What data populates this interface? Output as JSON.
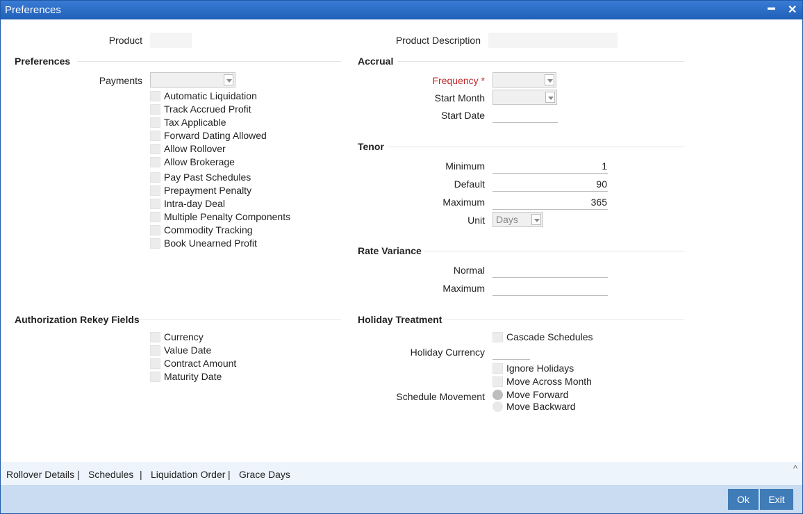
{
  "window": {
    "title": "Preferences",
    "minimize": "▬",
    "close": "✕"
  },
  "header": {
    "product_label": "Product",
    "product_value": "",
    "desc_label": "Product Description",
    "desc_value": ""
  },
  "preferences": {
    "title": "Preferences",
    "payments_label": "Payments",
    "payments_value": "",
    "checkboxes": [
      "Automatic Liquidation",
      "Track Accrued Profit",
      "Tax Applicable",
      "Forward Dating Allowed",
      "Allow Rollover",
      "Allow Brokerage",
      "Pay Past Schedules",
      "Prepayment Penalty",
      "Intra-day Deal",
      "Multiple Penalty Components",
      "Commodity Tracking",
      "Book Unearned Profit"
    ]
  },
  "accrual": {
    "title": "Accrual",
    "frequency_label": "Frequency",
    "required_mark": "*",
    "frequency_value": "",
    "start_month_label": "Start Month",
    "start_month_value": "",
    "start_date_label": "Start Date",
    "start_date_value": ""
  },
  "tenor": {
    "title": "Tenor",
    "minimum_label": "Minimum",
    "minimum_value": "1",
    "default_label": "Default",
    "default_value": "90",
    "maximum_label": "Maximum",
    "maximum_value": "365",
    "unit_label": "Unit",
    "unit_value": "Days"
  },
  "rate_variance": {
    "title": "Rate Variance",
    "normal_label": "Normal",
    "normal_value": "",
    "maximum_label": "Maximum",
    "maximum_value": ""
  },
  "auth_rekey": {
    "title": "Authorization Rekey Fields",
    "checkboxes": [
      "Currency",
      "Value Date",
      "Contract Amount",
      "Maturity Date"
    ]
  },
  "holiday": {
    "title": "Holiday Treatment",
    "cascade_label": "Cascade Schedules",
    "currency_label": "Holiday Currency",
    "currency_value": "",
    "ignore_label": "Ignore Holidays",
    "move_across_label": "Move Across Month",
    "schedule_movement_label": "Schedule Movement",
    "move_forward_label": "Move Forward",
    "move_backward_label": "Move Backward"
  },
  "footer": {
    "links": [
      "Rollover Details",
      "Schedules",
      "Liquidation Order",
      "Grace Days"
    ],
    "separator": "|",
    "collapse_glyph": "^"
  },
  "buttons": {
    "ok": "Ok",
    "exit": "Exit"
  },
  "colors": {
    "titlebar": "#2a6cc6",
    "button": "#3f7cb8",
    "required": "#c0262a",
    "footer": "#c9dcf1"
  }
}
